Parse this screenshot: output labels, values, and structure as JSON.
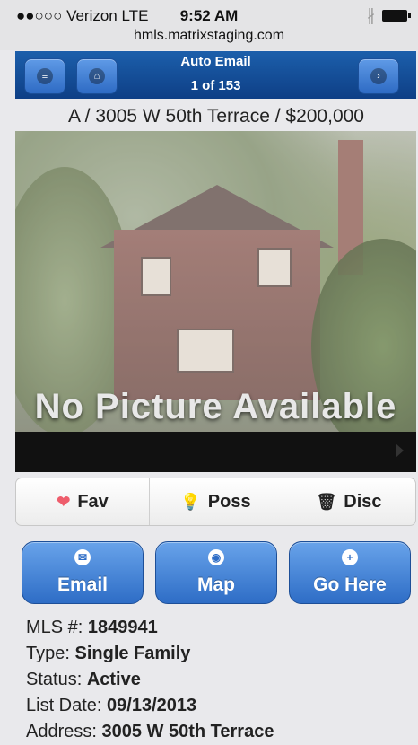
{
  "status_bar": {
    "carrier": "●●○○○ Verizon  LTE",
    "time": "9:52 AM",
    "bluetooth": "∦",
    "url": "hmls.matrixstaging.com"
  },
  "nav": {
    "title": "Auto Email",
    "count": "1 of 153",
    "icons": [
      "menu-icon",
      "home-icon",
      "next-icon"
    ]
  },
  "listing": {
    "heading": "A / 3005 W 50th Terrace / $200,000",
    "photo_text": "No Picture Available"
  },
  "tabs": [
    {
      "label": "Fav",
      "icon": "heart-icon",
      "glyph": "❤"
    },
    {
      "label": "Poss",
      "icon": "lightbulb-icon",
      "glyph": "💡"
    },
    {
      "label": "Disc",
      "icon": "trash-icon",
      "glyph": "🗑"
    }
  ],
  "actions": [
    {
      "label": "Email",
      "icon": "mail-icon",
      "glyph": "✉"
    },
    {
      "label": "Map",
      "icon": "map-icon",
      "glyph": "◉"
    },
    {
      "label": "Go Here",
      "icon": "plus-icon",
      "glyph": "+"
    }
  ],
  "details": [
    {
      "label": "MLS #: ",
      "value": "1849941"
    },
    {
      "label": "Type: ",
      "value": "Single Family"
    },
    {
      "label": "Status: ",
      "value": "Active"
    },
    {
      "label": "List Date: ",
      "value": "09/13/2013"
    },
    {
      "label": "Address: ",
      "value": "3005 W 50th Terrace"
    }
  ],
  "colors": {
    "nav_bar": "#1c5fab",
    "button_blue": "#2e6dc6",
    "background": "#e9e9ec"
  }
}
